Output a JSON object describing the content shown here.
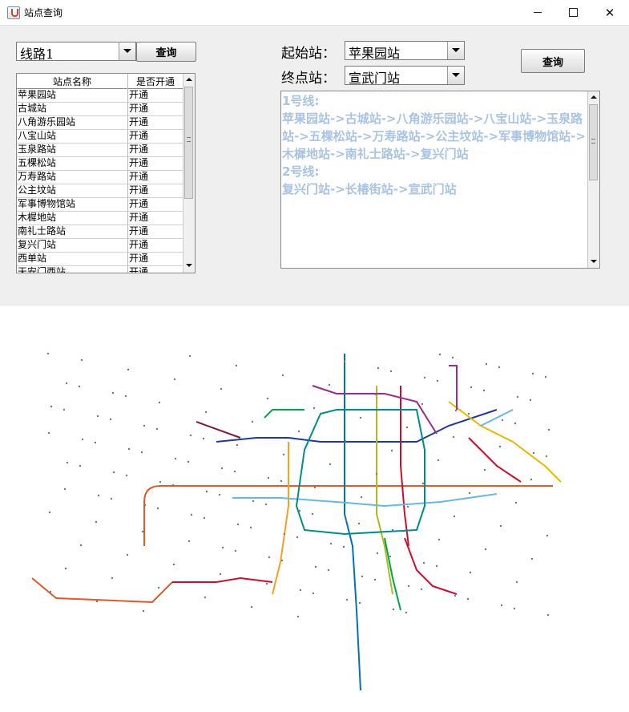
{
  "window": {
    "title": "站点查询",
    "controls": [
      "minimize",
      "maximize",
      "close"
    ]
  },
  "line_query": {
    "selected_line": "线路1",
    "query_button": "查询"
  },
  "route_query": {
    "start_label": "起始站：",
    "start_value": "苹果园站",
    "end_label": "终点站：",
    "end_value": "宣武门站",
    "query_button": "查询"
  },
  "station_table": {
    "columns": [
      "站点名称",
      "是否开通"
    ],
    "rows": [
      {
        "name": "苹果园站",
        "status": "开通"
      },
      {
        "name": "古城站",
        "status": "开通"
      },
      {
        "name": "八角游乐园站",
        "status": "开通"
      },
      {
        "name": "八宝山站",
        "status": "开通"
      },
      {
        "name": "玉泉路站",
        "status": "开通"
      },
      {
        "name": "五棵松站",
        "status": "开通"
      },
      {
        "name": "万寿路站",
        "status": "开通"
      },
      {
        "name": "公主坟站",
        "status": "开通"
      },
      {
        "name": "军事博物馆站",
        "status": "开通"
      },
      {
        "name": "木樨地站",
        "status": "开通"
      },
      {
        "name": "南礼士路站",
        "status": "开通"
      },
      {
        "name": "复兴门站",
        "status": "开通"
      },
      {
        "name": "西单站",
        "status": "开通"
      },
      {
        "name": "天安门西站",
        "status": "开通"
      }
    ]
  },
  "route_result": {
    "lines": [
      "1号线:",
      "苹果园站->古城站->八角游乐园站->八宝山站->玉泉路站->五棵松站->万寿路站->公主坟站->军事博物馆站->木樨地站->南礼士路站->复兴门站",
      "2号线:",
      "复兴门站->长椿街站->宣武门站"
    ],
    "text_color": "#a9c3e2"
  },
  "map": {
    "description_icon": "subway-map-image",
    "line_colors": [
      "#c8102e",
      "#0072bc",
      "#f4a21e",
      "#00a550",
      "#9b2a8c",
      "#e05a28",
      "#6ab8e0",
      "#b0bb1c",
      "#1f3a93",
      "#7a1f3a",
      "#008c8c",
      "#e8b800"
    ]
  }
}
